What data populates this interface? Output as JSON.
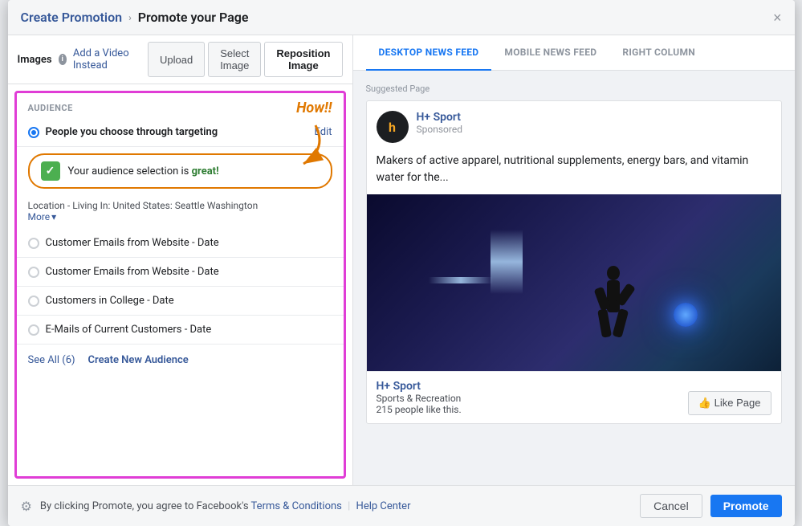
{
  "modal": {
    "title": "Promote your Page",
    "breadcrumb_link": "Create Promotion",
    "close_label": "×"
  },
  "image_toolbar": {
    "images_label": "Images",
    "add_video_label": "Add a Video Instead",
    "upload_label": "Upload",
    "select_image_label": "Select Image",
    "reposition_image_label": "Reposition Image"
  },
  "audience": {
    "section_label": "AUDIENCE",
    "how_annotation": "How!!",
    "option_label": "People you choose through targeting",
    "edit_label": "Edit",
    "selection_text_prefix": "Your audience selection is ",
    "selection_quality": "great!",
    "location_text": "Location - Living In: United States: Seattle Washington",
    "more_label": "More",
    "list_items": [
      "Customer Emails from Website - Date",
      "Customer Emails from Website - Date",
      "Customers in College - Date",
      "E-Mails of Current Customers - Date"
    ],
    "see_all_label": "See All (6)",
    "create_audience_label": "Create New Audience"
  },
  "preview": {
    "tabs": [
      {
        "label": "DESKTOP NEWS FEED",
        "active": true
      },
      {
        "label": "MOBILE NEWS FEED",
        "active": false
      },
      {
        "label": "RIGHT COLUMN",
        "active": false
      }
    ],
    "suggested_label": "Suggested Page",
    "page_avatar_letter": "h",
    "page_name": "H+ Sport",
    "sponsored_text": "Sponsored",
    "ad_text": "Makers of active apparel, nutritional supplements, energy bars, and vitamin water for the...",
    "footer_page_name": "H+ Sport",
    "page_category": "Sports & Recreation",
    "page_likes": "215 people like this.",
    "like_button_label": "👍 Like Page"
  },
  "footer": {
    "policy_text": "By clicking Promote, you agree to Facebook's ",
    "terms_label": "Terms & Conditions",
    "divider": "|",
    "help_label": "Help Center",
    "cancel_label": "Cancel",
    "promote_label": "Promote"
  }
}
